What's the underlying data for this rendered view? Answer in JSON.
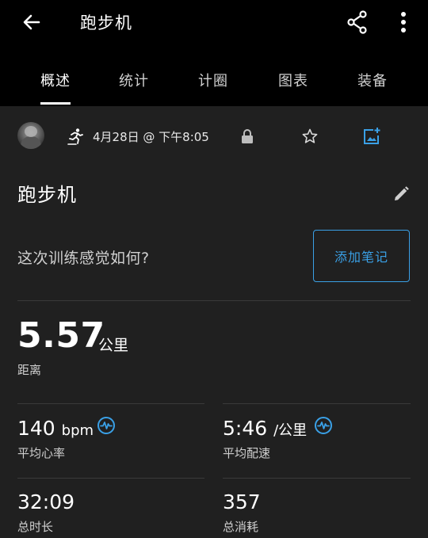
{
  "header": {
    "title": "跑步机"
  },
  "tabs": [
    {
      "label": "概述",
      "active": true
    },
    {
      "label": "统计",
      "active": false
    },
    {
      "label": "计圈",
      "active": false
    },
    {
      "label": "图表",
      "active": false
    },
    {
      "label": "装备",
      "active": false
    }
  ],
  "info": {
    "date": "4月28日 @ 下午8:05",
    "icons": [
      "treadmill-run-icon",
      "lock-icon",
      "star-icon",
      "add-photo-icon"
    ]
  },
  "activity": {
    "name": "跑步机"
  },
  "feeling": {
    "question": "这次训练感觉如何?",
    "add_note_label": "添加笔记"
  },
  "distance": {
    "value": "5.57",
    "unit": "公里",
    "label": "距离"
  },
  "stats": {
    "heart_rate": {
      "value": "140",
      "unit": "bpm",
      "label": "平均心率"
    },
    "pace": {
      "value": "5:46",
      "unit": "/公里",
      "label": "平均配速"
    },
    "duration": {
      "value": "32:09",
      "label": "总时长"
    },
    "calories": {
      "value": "357",
      "label": "总消耗"
    }
  },
  "colors": {
    "accent": "#3aa0e6",
    "background": "#202020",
    "header": "#000000"
  }
}
